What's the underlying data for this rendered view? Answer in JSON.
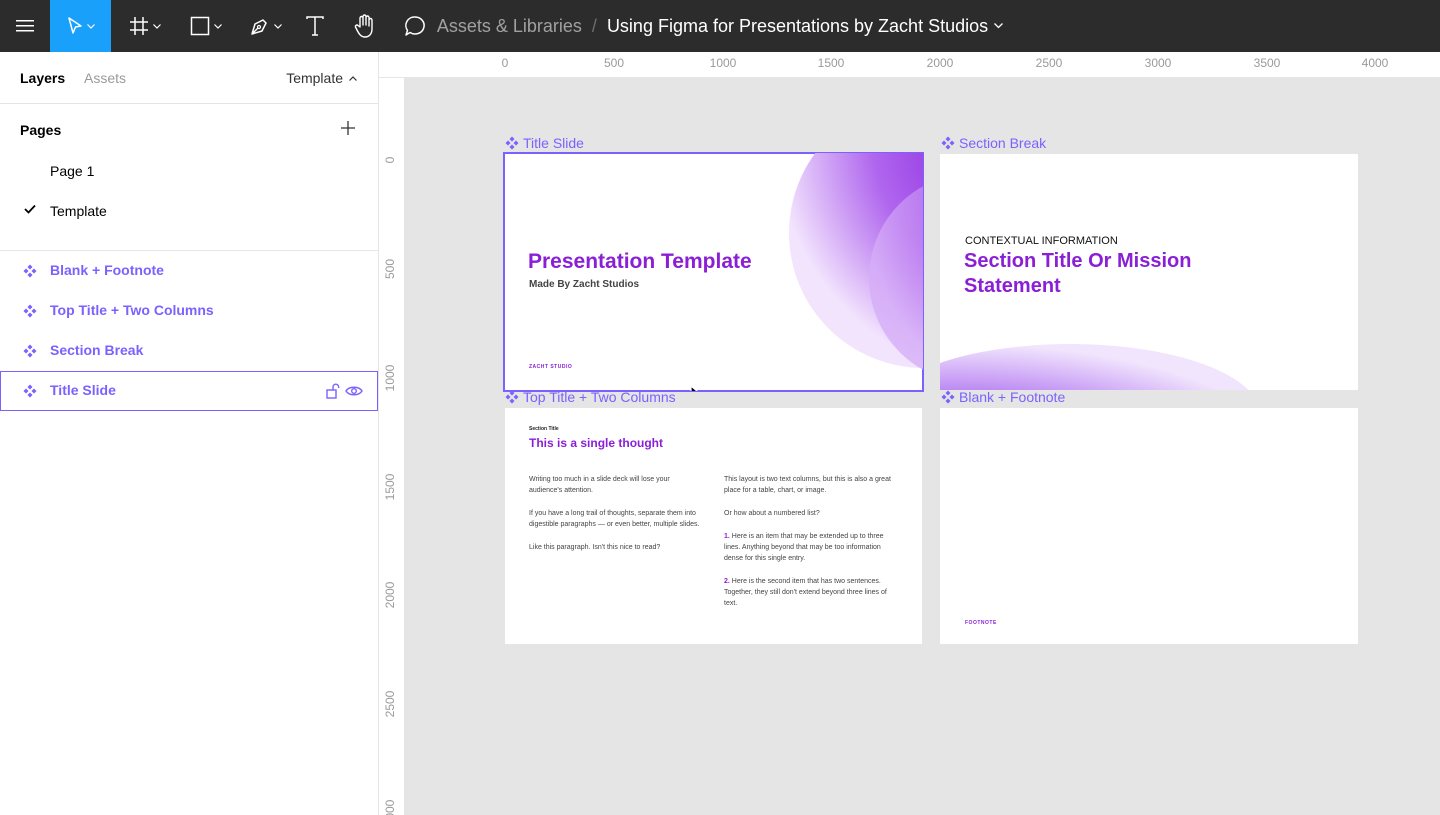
{
  "toolbar": {
    "breadcrumb_project": "Assets & Libraries",
    "breadcrumb_separator": "/",
    "file_name": "Using Figma for Presentations by Zacht Studios",
    "active_tool": "move",
    "accent_color": "#18a0fb"
  },
  "sidebar": {
    "tabs": {
      "layers": "Layers",
      "assets": "Assets",
      "current_page": "Template"
    },
    "pages_title": "Pages",
    "pages": [
      {
        "label": "Page 1",
        "active": false
      },
      {
        "label": "Template",
        "active": true
      }
    ],
    "layers": [
      {
        "label": "Blank + Footnote",
        "icon": "component-icon"
      },
      {
        "label": "Top Title + Two Columns",
        "icon": "component-icon"
      },
      {
        "label": "Section Break",
        "icon": "component-icon"
      },
      {
        "label": "Title Slide",
        "icon": "component-icon",
        "selected": true
      }
    ],
    "layer_color": "#7b61ff"
  },
  "rulers": {
    "top": [
      "0",
      "500",
      "1000",
      "1500",
      "2000",
      "2500",
      "3000",
      "3500",
      "4000"
    ],
    "left": [
      "0",
      "500",
      "1000",
      "1500",
      "2000",
      "2500",
      "3000"
    ]
  },
  "frames": {
    "title_slide": {
      "label": "Title Slide",
      "title": "Presentation Template",
      "subtitle": "Made By Zacht Studios",
      "footer": "ZACHT STUDIO"
    },
    "section_break": {
      "label": "Section Break",
      "context": "CONTEXTUAL INFORMATION",
      "title": "Section Title Or Mission Statement"
    },
    "two_columns": {
      "label": "Top Title + Two Columns",
      "section": "Section Title",
      "heading": "This is a single thought",
      "col1": [
        "Writing too much in a slide deck will lose your audience's attention.",
        "If you have a long trail of thoughts, separate them into digestible paragraphs — or even better, multiple slides.",
        "Like this paragraph. Isn't this nice to read?"
      ],
      "col2_p1": "This layout is two text columns, but this is also a great place for a table, chart, or image.",
      "col2_p2": "Or how about a numbered list?",
      "item1_num": "1.",
      "item1": " Here is an item that may be extended up to three lines. Anything beyond that may be too information dense for this single entry.",
      "item2_num": "2.",
      "item2": " Here is the second item that has two sentences. Together, they still don't extend beyond three lines of text."
    },
    "blank_footnote": {
      "label": "Blank + Footnote",
      "footer": "FOOTNOTE"
    },
    "brand_purple": "#8a1fd6"
  }
}
